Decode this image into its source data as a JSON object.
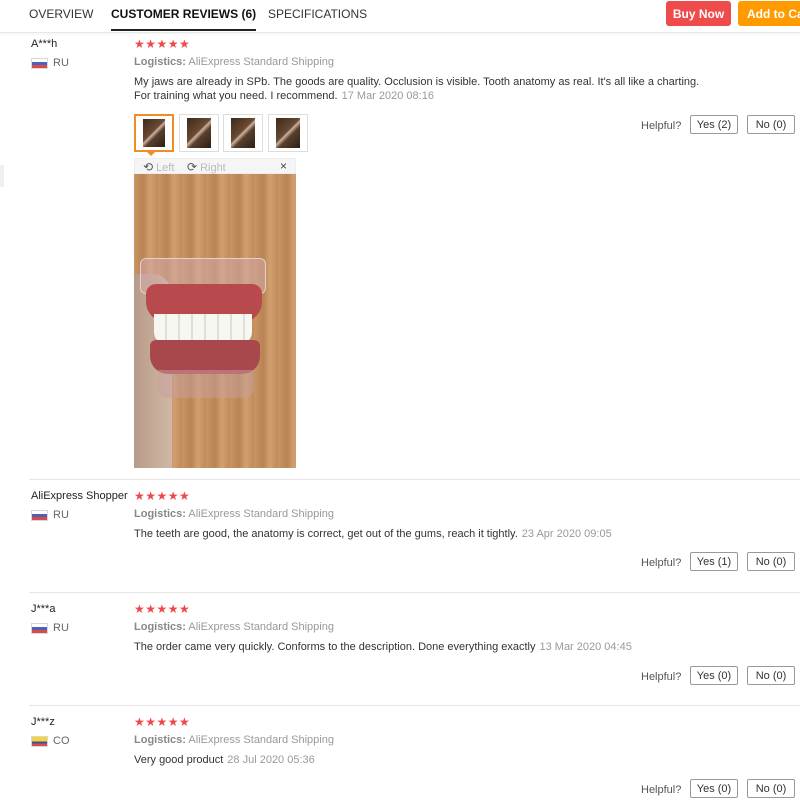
{
  "tabs": [
    {
      "label": "OVERVIEW",
      "active": false
    },
    {
      "label": "CUSTOMER REVIEWS (6)",
      "active": true
    },
    {
      "label": "SPECIFICATIONS",
      "active": false
    }
  ],
  "actions": {
    "buy_now": "Buy Now",
    "add_to_cart": "Add to Cart"
  },
  "colors": {
    "buy_now": "#f04b4b",
    "add_to_cart": "#ff9a00",
    "stars": "#f0484a",
    "selected_thumb": "#f28c28"
  },
  "labels": {
    "logistics": "Logistics:",
    "helpful": "Helpful?",
    "rotate_left": "Left",
    "rotate_right": "Right",
    "close": "×"
  },
  "icons": {
    "star": "★",
    "rotate_left": "⟲",
    "rotate_right": "⟳"
  },
  "reviews": [
    {
      "name": "A***h",
      "country": "RU",
      "flag": "russia-flag-icon",
      "rating": 5,
      "stars": "★★★★★",
      "shipping": "AliExpress Standard Shipping",
      "text_lines": [
        "My jaws are already in SPb. The goods are quality. Occlusion is visible. Tooth anatomy as real. It's all like a charting.",
        "For training what you need. I recommend."
      ],
      "date": "17 Mar 2020 08:16",
      "yes": "Yes (2)",
      "no": "No (0)",
      "photo_count": 4
    },
    {
      "name": "AliExpress Shopper",
      "country": "RU",
      "flag": "russia-flag-icon",
      "rating": 5,
      "stars": "★★★★★",
      "shipping": "AliExpress Standard Shipping",
      "text_lines": [
        "The teeth are good, the anatomy is correct, get out of the gums, reach it tightly."
      ],
      "date": "23 Apr 2020 09:05",
      "yes": "Yes (1)",
      "no": "No (0)"
    },
    {
      "name": "J***a",
      "country": "RU",
      "flag": "russia-flag-icon",
      "rating": 5,
      "stars": "★★★★★",
      "shipping": "AliExpress Standard Shipping",
      "text_lines": [
        "The order came very quickly. Conforms to the description. Done everything exactly"
      ],
      "date": "13 Mar 2020 04:45",
      "yes": "Yes (0)",
      "no": "No (0)"
    },
    {
      "name": "J***z",
      "country": "CO",
      "flag": "colombia-flag-icon",
      "rating": 5,
      "stars": "★★★★★",
      "shipping": "AliExpress Standard Shipping",
      "text_lines": [
        "Very good product"
      ],
      "date": "28 Jul 2020 05:36",
      "yes": "Yes (0)",
      "no": "No (0)"
    }
  ]
}
